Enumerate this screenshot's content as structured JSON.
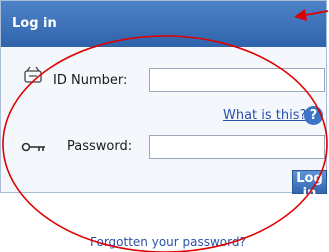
{
  "header": {
    "title": "Log in"
  },
  "form": {
    "id_label": "ID Number:",
    "id_value": "",
    "help_link": "What is this?",
    "help_icon_glyph": "?",
    "password_label": "Password:",
    "password_value": "",
    "login_button": "Log in"
  },
  "footer": {
    "forgot_link": "Forgotten your password?"
  },
  "icons": {
    "id": "id-card-icon",
    "password": "key-icon",
    "help": "help-icon"
  },
  "colors": {
    "header": "#3b6fb8",
    "accent": "#2a52a8",
    "annotation": "#e00000"
  }
}
